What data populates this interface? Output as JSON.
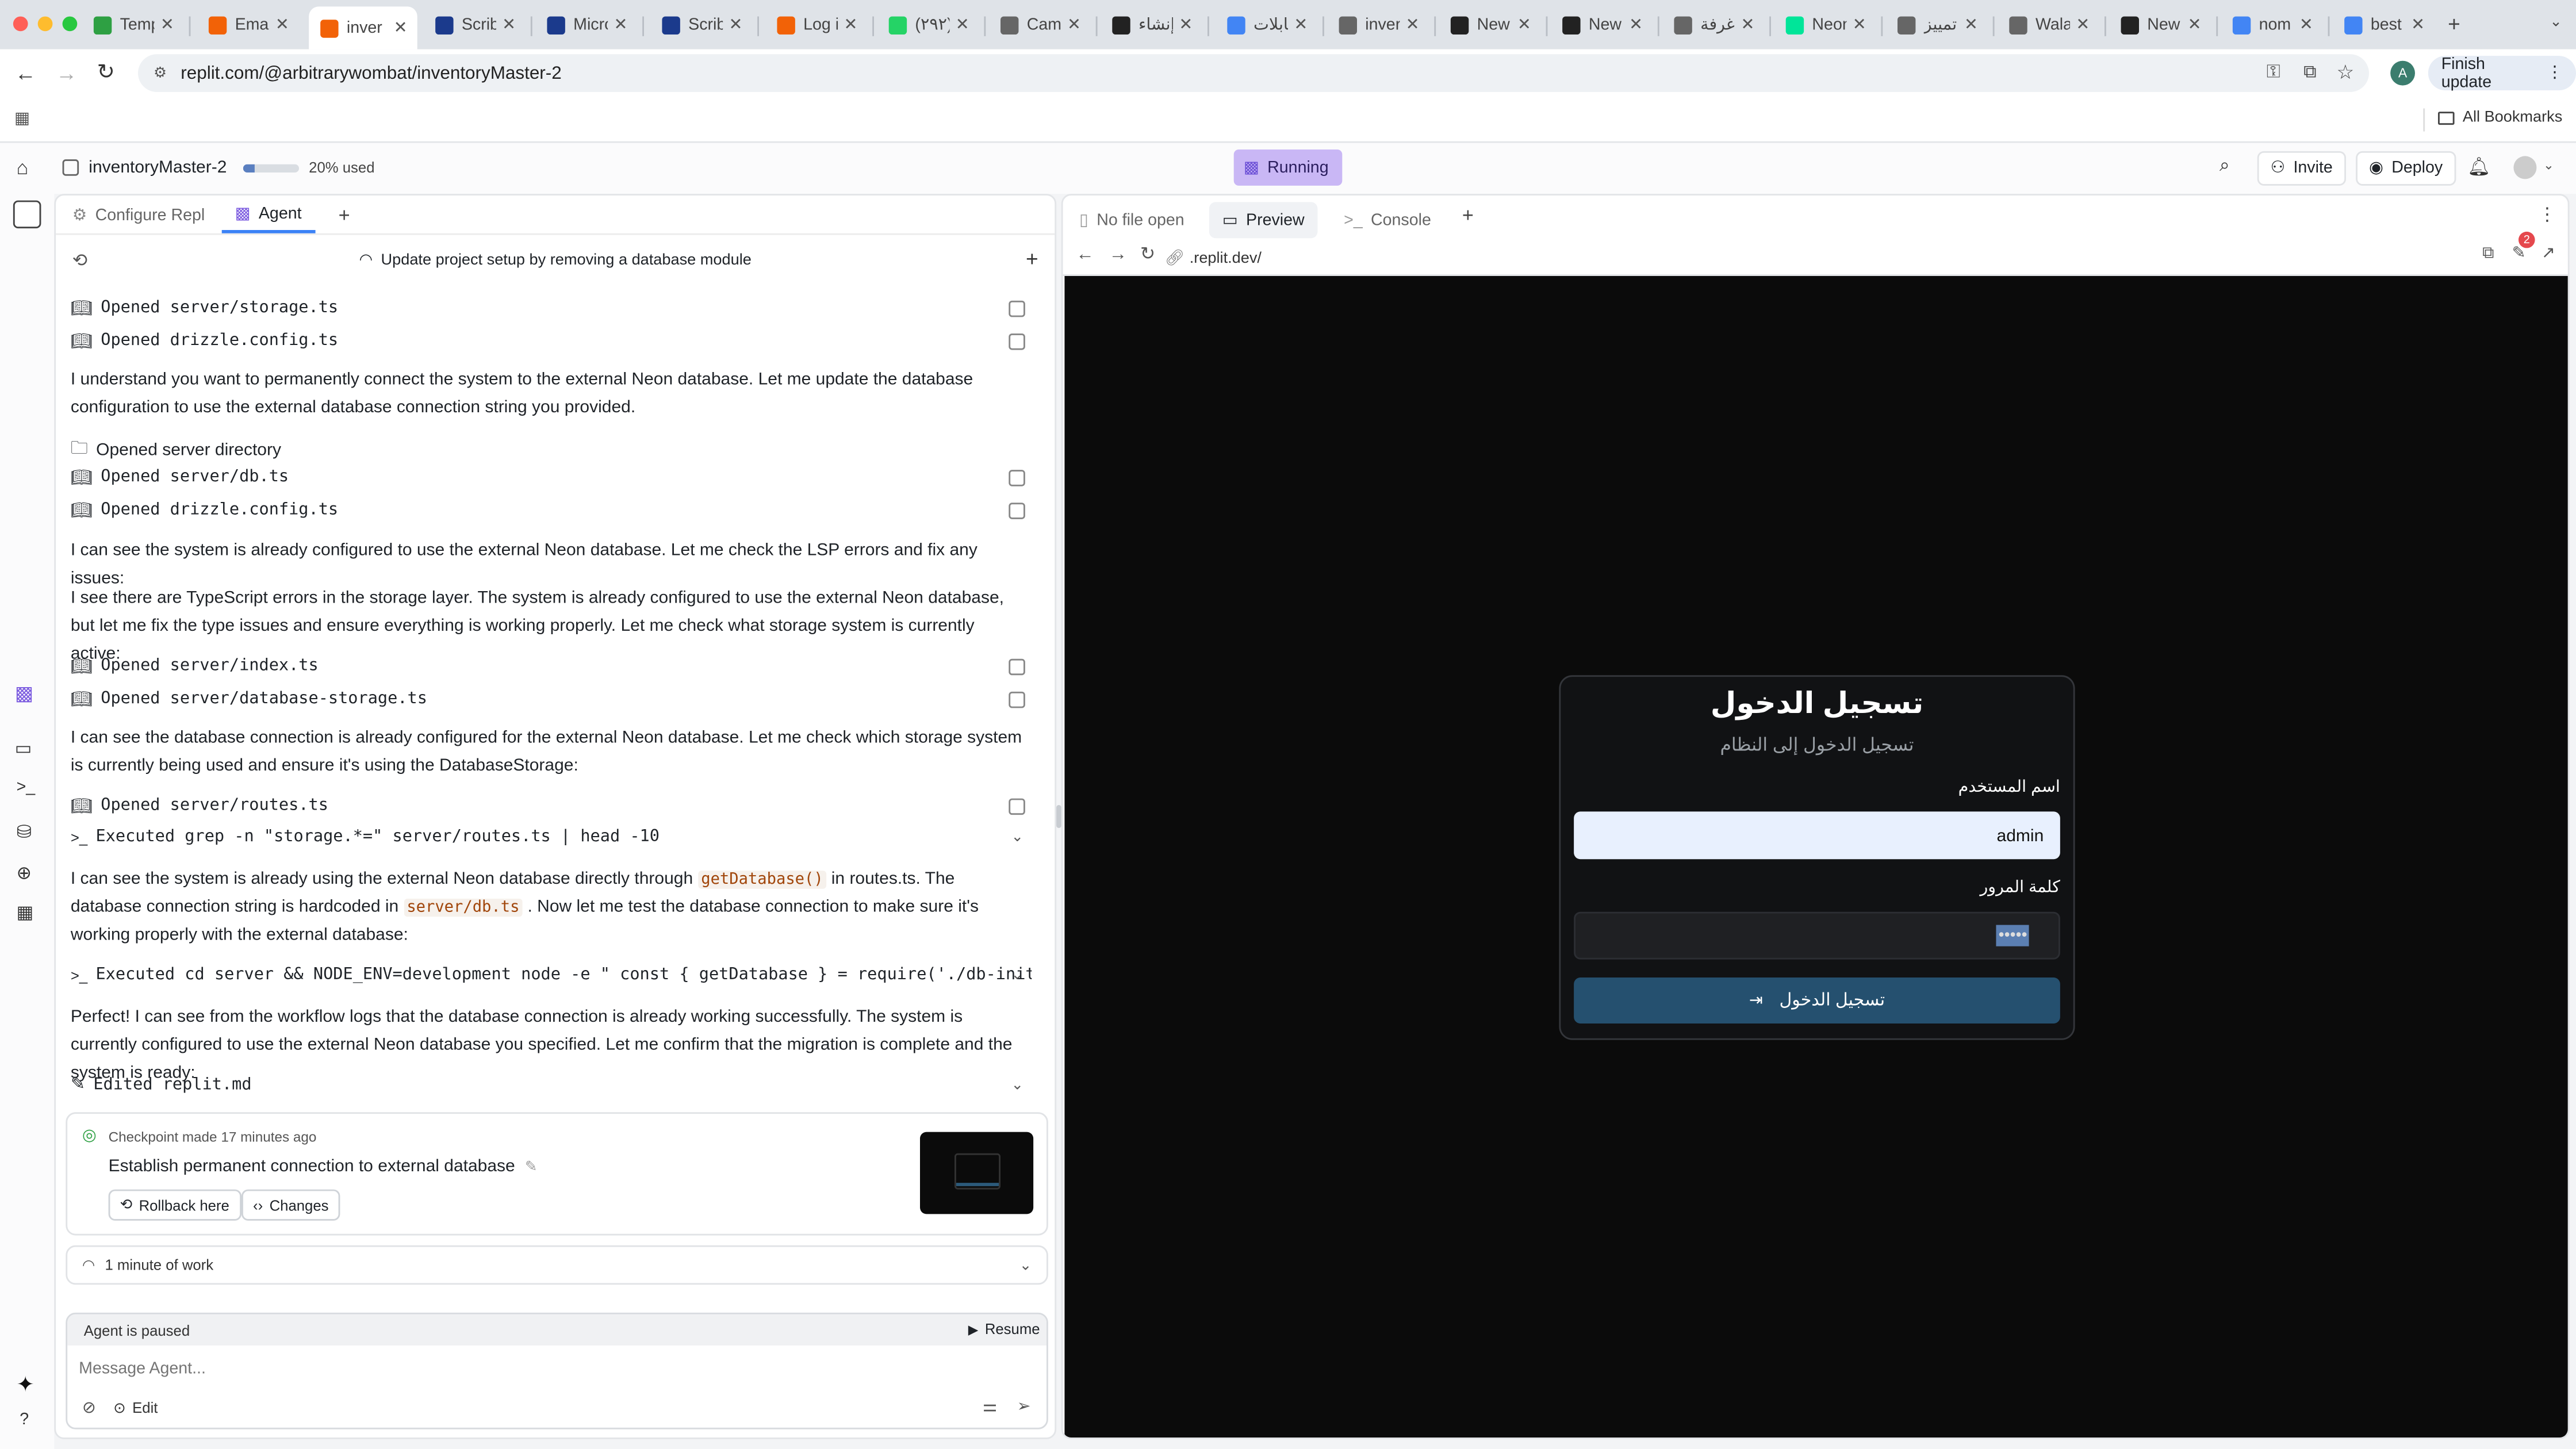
{
  "browser": {
    "tabs": [
      {
        "label": "Temp",
        "icon": "shield-icon",
        "color": "#2ea043"
      },
      {
        "label": "Emai",
        "icon": "replit-icon",
        "color": "#f26207"
      },
      {
        "label": "inver",
        "icon": "replit-icon",
        "color": "#f26207",
        "active": true
      },
      {
        "label": "Scrib",
        "icon": "scribd-icon",
        "color": "#1b3a8c"
      },
      {
        "label": "Micro",
        "icon": "microsoft-icon",
        "color": "#1b3a8c"
      },
      {
        "label": "Scrib",
        "icon": "scribd-icon",
        "color": "#1b3a8c"
      },
      {
        "label": "Log i",
        "icon": "replit-icon",
        "color": "#f26207"
      },
      {
        "label": "(٢٩٢)",
        "icon": "whatsapp-icon",
        "color": "#25d366"
      },
      {
        "label": "Cam",
        "icon": "globe-icon",
        "color": "#666"
      },
      {
        "label": "إنشاء",
        "icon": "openai-icon",
        "color": "#222"
      },
      {
        "label": "كابلات",
        "icon": "google-icon",
        "color": "#4285f4"
      },
      {
        "label": "inver",
        "icon": "globe-icon",
        "color": "#666"
      },
      {
        "label": "New",
        "icon": "openai-icon",
        "color": "#222"
      },
      {
        "label": "New",
        "icon": "openai-icon",
        "color": "#222"
      },
      {
        "label": "غرفة",
        "icon": "globe-icon",
        "color": "#666"
      },
      {
        "label": "Neon",
        "icon": "neon-icon",
        "color": "#00e599"
      },
      {
        "label": "تمييز",
        "icon": "globe-icon",
        "color": "#666"
      },
      {
        "label": "Wala",
        "icon": "globe-icon",
        "color": "#666"
      },
      {
        "label": "New",
        "icon": "openai-icon",
        "color": "#222"
      },
      {
        "label": "nom",
        "icon": "google-icon",
        "color": "#4285f4"
      },
      {
        "label": "best",
        "icon": "google-icon",
        "color": "#4285f4"
      }
    ],
    "url": "replit.com/@arbitrarywombat/inventoryMaster-2",
    "finish_update": "Finish update",
    "profile_initial": "A",
    "all_bookmarks": "All Bookmarks"
  },
  "header": {
    "project_name": "inventoryMaster-2",
    "usage_text": "20% used",
    "usage_fraction": 0.2,
    "status": "Running",
    "invite": "Invite",
    "deploy": "Deploy"
  },
  "left_tabs": {
    "configure": "Configure Repl",
    "agent": "Agent"
  },
  "agent": {
    "title": "Update project setup by removing a database module",
    "items": {
      "o1": "Opened server/storage.ts",
      "o2": "Opened drizzle.config.ts",
      "p1": "I understand you want to permanently connect the system to the external Neon database. Let me update the database configuration to use the external database connection string you provided.",
      "o3": "Opened server directory",
      "o4": "Opened server/db.ts",
      "o5": "Opened drizzle.config.ts",
      "p2": "I can see the system is already configured to use the external Neon database. Let me check the LSP errors and fix any issues:",
      "p3": "I see there are TypeScript errors in the storage layer. The system is already configured to use the external Neon database, but let me fix the type issues and ensure everything is working properly. Let me check what storage system is currently active:",
      "o6": "Opened server/index.ts",
      "o7": "Opened server/database-storage.ts",
      "p4": "I can see the database connection is already configured for the external Neon database. Let me check which storage system is currently being used and ensure it's using the DatabaseStorage:",
      "o8": "Opened server/routes.ts",
      "e1": "Executed grep -n \"storage.*=\" server/routes.ts | head -10",
      "p5a": "I can see the system is already using the external Neon database directly through",
      "p5code1": "getDatabase()",
      "p5b": "in routes.ts. The database connection string is hardcoded in",
      "p5code2": "server/db.ts",
      "p5c": ". Now let me test the database connection to make sure it's working properly with the external database:",
      "e2": "Executed cd server && NODE_ENV=development node -e \" const { getDatabase } = require('./db-init.js'); …",
      "p6": "Perfect! I can see from the workflow logs that the database connection is already working successfully. The system is currently configured to use the external Neon database you specified. Let me confirm that the migration is complete and the system is ready:",
      "ed1": "Edited replit.md"
    },
    "checkpoint": {
      "meta": "Checkpoint made 17 minutes ago",
      "title": "Establish permanent connection to external database",
      "rollback": "Rollback here",
      "changes": "Changes"
    },
    "work": "1 minute of work",
    "paused": "Agent is paused",
    "resume": "Resume",
    "placeholder": "Message Agent...",
    "edit": "Edit"
  },
  "right_tabs": {
    "nofile": "No file open",
    "preview": "Preview",
    "console": "Console"
  },
  "preview": {
    "url": ".replit.dev/",
    "badge": "2",
    "login": {
      "title": "تسجيل الدخول",
      "subtitle": "تسجيل الدخول إلى النظام",
      "user_label": "اسم المستخدم",
      "user_value": "admin",
      "pass_label": "كلمة المرور",
      "pass_value": "•••••",
      "submit": "تسجيل الدخول"
    }
  }
}
